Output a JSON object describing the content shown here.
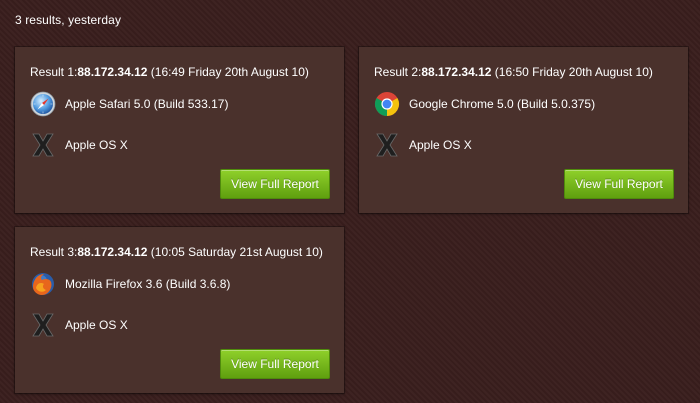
{
  "summary": "3 results, yesterday",
  "results": [
    {
      "prefix": "Result 1:",
      "ip": "88.172.34.12",
      "timestamp": " (16:49 Friday 20th August 10)",
      "browser": {
        "name": "Apple Safari 5.0 (Build 533.17)",
        "icon": "safari-icon"
      },
      "os": {
        "name": "Apple OS X",
        "icon": "apple-osx-icon"
      },
      "button": "View Full Report"
    },
    {
      "prefix": "Result 2:",
      "ip": "88.172.34.12",
      "timestamp": " (16:50 Friday 20th August 10)",
      "browser": {
        "name": "Google Chrome 5.0 (Build 5.0.375)",
        "icon": "chrome-icon"
      },
      "os": {
        "name": "Apple OS X",
        "icon": "apple-osx-icon"
      },
      "button": "View Full Report"
    },
    {
      "prefix": "Result 3:",
      "ip": "88.172.34.12",
      "timestamp": " (10:05 Saturday 21st August 10)",
      "browser": {
        "name": "Mozilla Firefox 3.6 (Build 3.6.8)",
        "icon": "firefox-icon"
      },
      "os": {
        "name": "Apple OS X",
        "icon": "apple-osx-icon"
      },
      "button": "View Full Report"
    }
  ],
  "colors": {
    "background": "#3a1f1e",
    "card": "#4a312c",
    "button": "#76b81c",
    "text": "#ffffff"
  }
}
